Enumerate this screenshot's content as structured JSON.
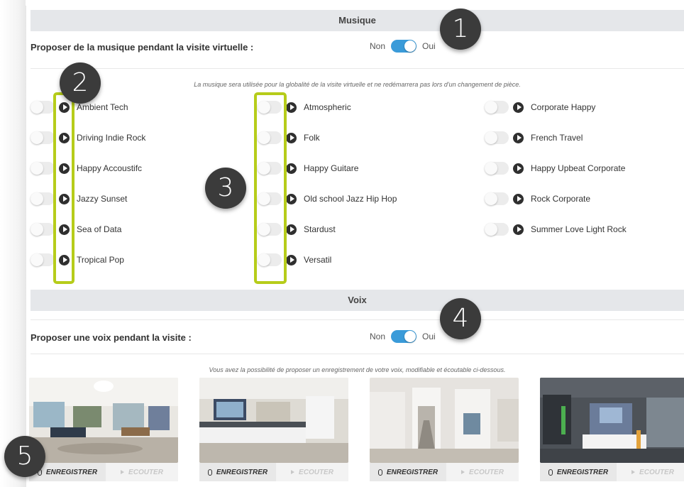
{
  "music": {
    "header": "Musique",
    "question": "Proposer de la musique pendant la visite virtuelle :",
    "toggle_off_label": "Non",
    "toggle_on_label": "Oui",
    "toggle_state": "on",
    "note": "La musique sera utilisée pour la globalité de la visite virtuelle et ne redémarrera pas lors d'un changement de pièce.",
    "columns": [
      {
        "tracks": [
          "Ambient Tech",
          "Driving Indie Rock",
          "Happy Accoustifc",
          "Jazzy Sunset",
          "Sea of Data",
          "Tropical Pop"
        ]
      },
      {
        "tracks": [
          "Atmospheric",
          "Folk",
          "Happy Guitare",
          "Old school Jazz Hip Hop",
          "Stardust",
          "Versatil"
        ]
      },
      {
        "tracks": [
          "Corporate Happy",
          "French Travel",
          "Happy Upbeat Corporate",
          "Rock Corporate",
          "Summer Love Light Rock"
        ]
      }
    ]
  },
  "voice": {
    "header": "Voix",
    "question": "Proposer une voix pendant la visite :",
    "toggle_off_label": "Non",
    "toggle_on_label": "Oui",
    "toggle_state": "on",
    "note": "Vous avez la possibilité de proposer un enregistrement de votre voix, modifiable et écoutable ci-dessous.",
    "record_label": "ENREGISTRER",
    "listen_label": "ECOUTER"
  },
  "annotations": [
    "1",
    "2",
    "3",
    "4",
    "5"
  ],
  "colors": {
    "accent": "#3a9bd9",
    "highlight": "#b6cc1a",
    "badge": "#3b3b3b",
    "header_bg": "#e5e7ea"
  }
}
